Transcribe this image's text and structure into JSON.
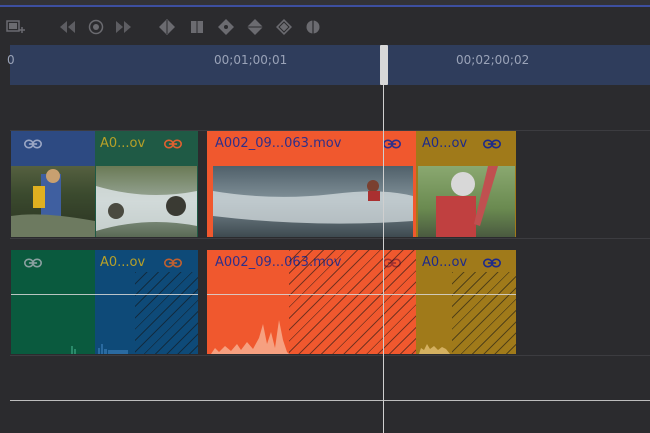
{
  "timeline": {
    "ruler": {
      "start_label": "0",
      "tc1": "00;01;00;01",
      "tc2": "00;02;00;02"
    },
    "clips": {
      "v1": {
        "title": ""
      },
      "v2": {
        "title": "A0...ov"
      },
      "v3": {
        "title": "A002_09...063.mov"
      },
      "v4": {
        "title": "A0...ov"
      },
      "a1": {
        "title": ""
      },
      "a2": {
        "title": "A0...ov"
      },
      "a3": {
        "title": "A002_09...063.mov"
      },
      "a4": {
        "title": "A0...ov"
      }
    },
    "colors": {
      "video_clip_blue": "#2d4a82",
      "video_clip_green": "#1f5a45",
      "orange": "#f0582e",
      "gold": "#a07a1a",
      "audio_teal": "#0a5a3e",
      "audio_blue": "#0e4a78"
    },
    "icons": [
      "add-track-icon",
      "skip-back-icon",
      "record-icon",
      "skip-forward-icon",
      "keyframe-icon",
      "stop-icon",
      "keyframe-icon",
      "keyframe-icon",
      "keyframe-icon",
      "split-icon",
      "link-icon"
    ]
  }
}
